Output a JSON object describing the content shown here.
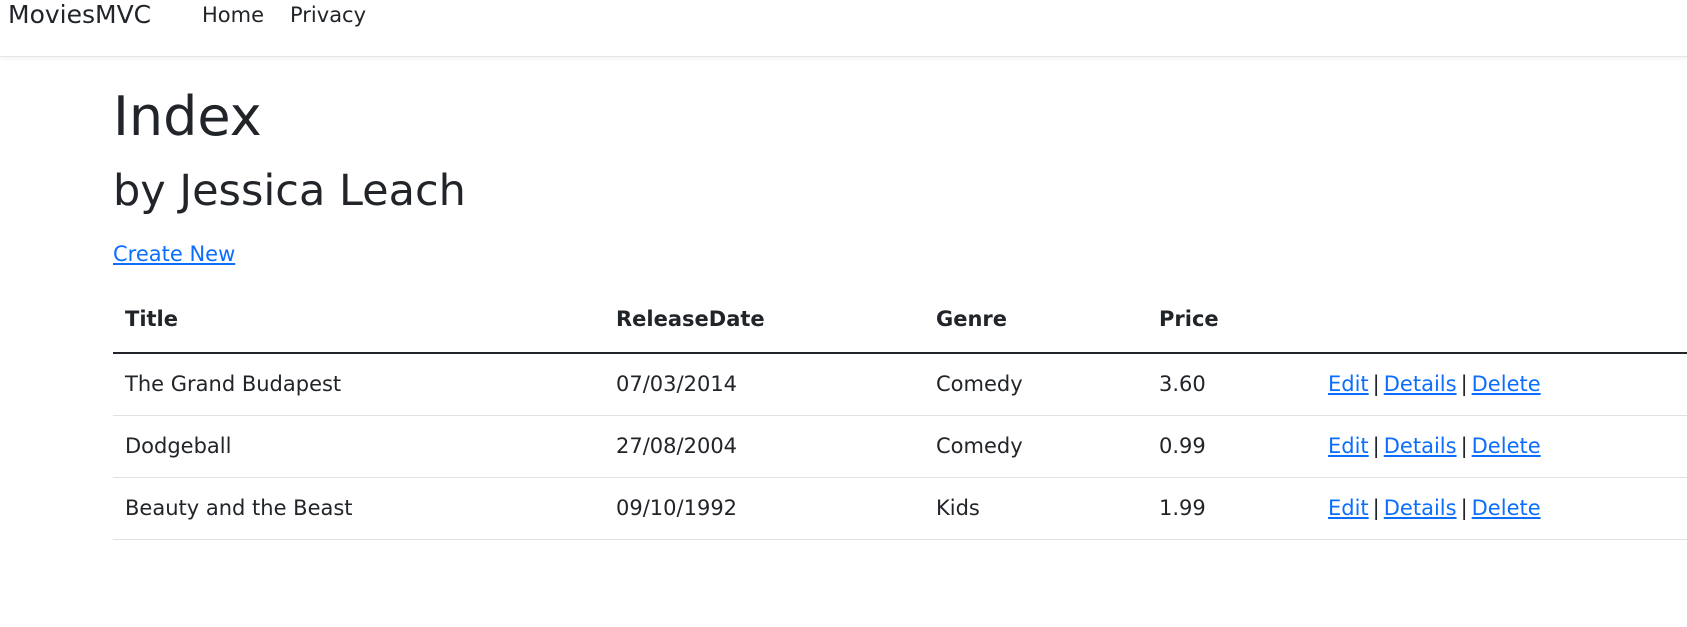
{
  "navbar": {
    "brand": "MoviesMVC",
    "links": [
      {
        "label": "Home"
      },
      {
        "label": "Privacy"
      }
    ]
  },
  "main": {
    "title": "Index",
    "subtitle": "by Jessica Leach",
    "create_link": "Create New",
    "table": {
      "headers": [
        "Title",
        "ReleaseDate",
        "Genre",
        "Price",
        ""
      ],
      "rows": [
        {
          "title": "The Grand Budapest",
          "release_date": "07/03/2014",
          "genre": "Comedy",
          "price": "3.60"
        },
        {
          "title": "Dodgeball",
          "release_date": "27/08/2004",
          "genre": "Comedy",
          "price": "0.99"
        },
        {
          "title": "Beauty and the Beast",
          "release_date": "09/10/1992",
          "genre": "Kids",
          "price": "1.99"
        }
      ],
      "actions": {
        "edit": "Edit",
        "details": "Details",
        "delete": "Delete",
        "separator": "|"
      }
    }
  },
  "colors": {
    "link": "#0d6efd",
    "text": "#212529",
    "border": "#dee2e6"
  }
}
